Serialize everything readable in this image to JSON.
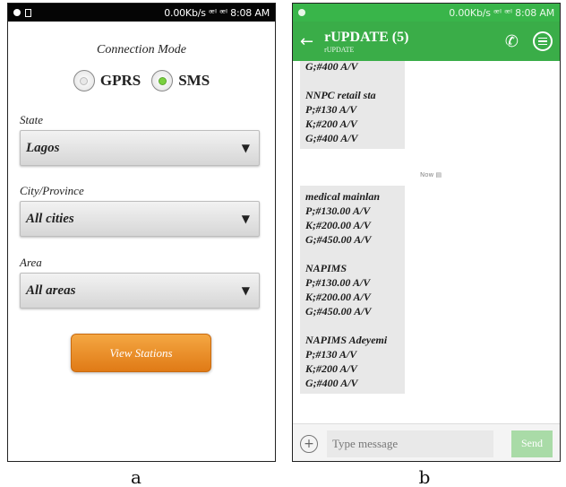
{
  "captions": {
    "a": "a",
    "b": "b"
  },
  "phone_a": {
    "status": {
      "right": "0.00Kb/s ᵆᴵ ᵆᴵ 8:08 AM"
    },
    "connection_mode": {
      "title": "Connection Mode",
      "options": [
        {
          "label": "GPRS",
          "selected": false
        },
        {
          "label": "SMS",
          "selected": true
        }
      ]
    },
    "state": {
      "label": "State",
      "value": "Lagos"
    },
    "city": {
      "label": "City/Province",
      "value": "All cities"
    },
    "area": {
      "label": "Area",
      "value": "All areas"
    },
    "view_button": "View Stations",
    "colors": {
      "button": "#e8881f",
      "radio_selected": "#7ad03f"
    }
  },
  "phone_b": {
    "status": {
      "right": "0.00Kb/s ᵆᴵ ᵆᴵ 8:08 AM"
    },
    "header": {
      "title": "rUPDATE (5)",
      "subtitle": "rUPDATE"
    },
    "messages": [
      {
        "lines": [
          "G;#400 A/V",
          "",
          "NNPC retail sta",
          "P;#130 A/V",
          "K;#200 A/V",
          "G;#400 A/V"
        ]
      },
      {
        "lines": [
          "medical mainlan",
          "P;#130.00 A/V",
          "K;#200.00 A/V",
          "G;#450.00 A/V",
          "",
          "NAPIMS",
          "P;#130.00 A/V",
          "K;#200.00 A/V",
          "G;#450.00 A/V",
          "",
          "NAPIMS Adeyemi",
          "P;#130 A/V",
          "K;#200 A/V",
          "G;#400 A/V"
        ]
      }
    ],
    "timestamp": "Now",
    "input": {
      "placeholder": "Type message"
    },
    "send_label": "Send",
    "colors": {
      "accent": "#3aad48",
      "send": "#a9dba7"
    }
  }
}
